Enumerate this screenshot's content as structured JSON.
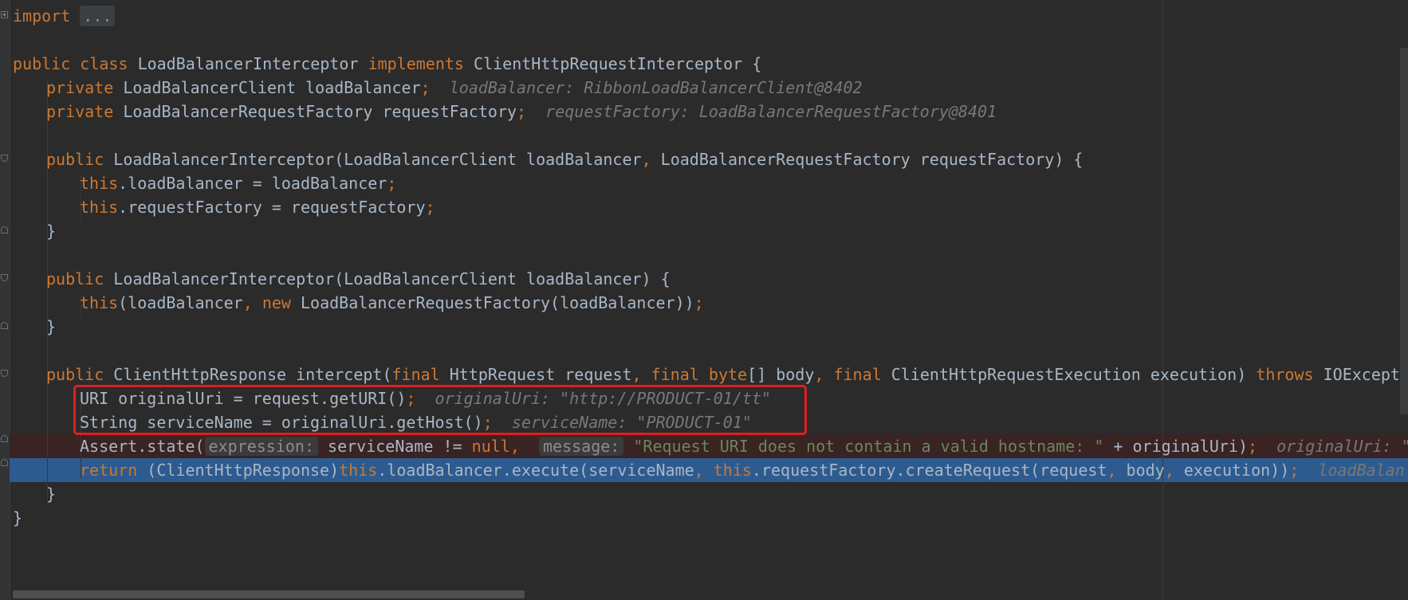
{
  "editor": {
    "lines": {
      "l1": {
        "kw": "import",
        "fold_text": "..."
      },
      "l3": {
        "kw1": "public",
        "kw2": "class",
        "name": "LoadBalancerInterceptor",
        "kw3": "implements",
        "iface": "ClientHttpRequestInterceptor {"
      },
      "l4": {
        "kw": "private",
        "code": "LoadBalancerClient loadBalancer",
        "semi": ";",
        "hint": "loadBalancer: RibbonLoadBalancerClient@8402"
      },
      "l5": {
        "kw": "private",
        "code": "LoadBalancerRequestFactory requestFactory",
        "semi": ";",
        "hint": "requestFactory: LoadBalancerRequestFactory@8401"
      },
      "l7": {
        "kw": "public",
        "code1": "LoadBalancerInterceptor(LoadBalancerClient loadBalancer",
        "comma": ",",
        "code2": "LoadBalancerRequestFactory requestFactory) {"
      },
      "l8": {
        "kw": "this",
        "code": ".loadBalancer = loadBalancer",
        "semi": ";"
      },
      "l9": {
        "kw": "this",
        "code": ".requestFactory = requestFactory",
        "semi": ";"
      },
      "l10": {
        "code": "}"
      },
      "l12": {
        "kw": "public",
        "code": "LoadBalancerInterceptor(LoadBalancerClient loadBalancer) {"
      },
      "l13": {
        "kw1": "this",
        "code1": "(loadBalancer",
        "comma": ",",
        "kw2": "new",
        "code2": "LoadBalancerRequestFactory(loadBalancer))",
        "semi": ";"
      },
      "l14": {
        "code": "}"
      },
      "l16": {
        "kw1": "public",
        "code1": "ClientHttpResponse intercept(",
        "kw2": "final",
        "code2": "HttpRequest request",
        "c1": ",",
        "kw3": "final",
        "kw4": "byte",
        "code3": "[] body",
        "c2": ",",
        "kw5": "final",
        "code4": "ClientHttpRequestExecution execution)",
        "kw6": "throws",
        "code5": "IOExcepti"
      },
      "l17": {
        "code": "URI originalUri = request.getURI()",
        "semi": ";",
        "hint": "originalUri: \"http://PRODUCT-01/tt\""
      },
      "l18": {
        "code": "String serviceName = originalUri.getHost()",
        "semi": ";",
        "hint": "serviceName: \"PRODUCT-01\""
      },
      "l19": {
        "code1": "Assert.state(",
        "badge1": "expression:",
        "code2": "serviceName != ",
        "kw1": "null",
        "comma": ",",
        "badge2": "message:",
        "str": "\"Request URI does not contain a valid hostname: \"",
        "code3": " + originalUri)",
        "semi": ";",
        "hint": "originalUri: \"htt"
      },
      "l20": {
        "kw1": "return",
        "code1": "(ClientHttpResponse)",
        "kw2": "this",
        "code2": ".loadBalancer.execute(serviceName",
        "c1": ",",
        "kw3": "this",
        "code3": ".requestFactory.createRequest(request",
        "c2": ",",
        "code4": "body",
        "c3": ",",
        "code5": "execution))",
        "semi": ";",
        "hint": "loadBalan"
      },
      "l21": {
        "code": "}"
      },
      "l22": {
        "code": "}"
      }
    },
    "colors": {
      "background": "#2b2b2b",
      "keyword": "#cc7832",
      "text": "#a9b7c6",
      "string": "#6a8759",
      "hint": "#787878",
      "execution_line": "#2d5b8f",
      "breakpoint_line": "#3a2323",
      "annotation_box": "#e01e1e"
    }
  }
}
